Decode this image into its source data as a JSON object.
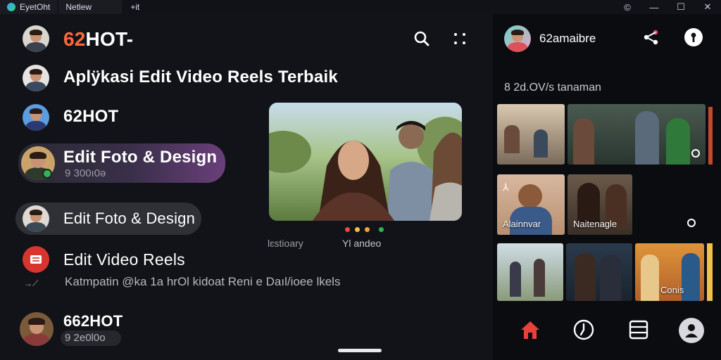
{
  "window": {
    "tabs": [
      {
        "label": "EyetOht"
      },
      {
        "label": "Netlew"
      },
      {
        "label": "+it"
      }
    ],
    "controls": [
      "©",
      "—",
      "☐",
      "✕"
    ]
  },
  "header": {
    "brand_prefix": "62",
    "brand_rest": "HOT-",
    "search_icon": "search-icon",
    "grid_icon": "grid-icon"
  },
  "list": [
    {
      "title": "Aplÿkasi Edit Video Reels Terbaik"
    },
    {
      "title": "62HOT"
    },
    {
      "title": "Edit Foto & Design",
      "subtitle": "9 300ı0ə"
    },
    {
      "title": "Edit Foto & Design"
    },
    {
      "title": "Edit Video Reels",
      "subtitle": "Katmpatin @ka 1a hrOl kidoat Reni e Daıl/ioee lkels"
    },
    {
      "title": "662HOT",
      "subtitle": "9 2e0l0o"
    }
  ],
  "preview": {
    "label_left": "lɛstioary",
    "label_right": "Yl andeo",
    "dots": [
      "#e84a3c",
      "#f2c14a",
      "#f2a23a",
      "#2fb35a"
    ]
  },
  "sidebar": {
    "profile_name": "62amaibre",
    "section_title": "8 2d.OV/s tanaman",
    "thumbs": [
      {
        "label": ""
      },
      {
        "label": ""
      },
      {
        "label": "Alainnvar"
      },
      {
        "label": "Naitenagle"
      },
      {
        "label": ""
      },
      {
        "label": ""
      },
      {
        "label": "Conis"
      }
    ],
    "colors": {
      "home": "#e8403a",
      "accent_pink": "#e84a6b"
    }
  }
}
